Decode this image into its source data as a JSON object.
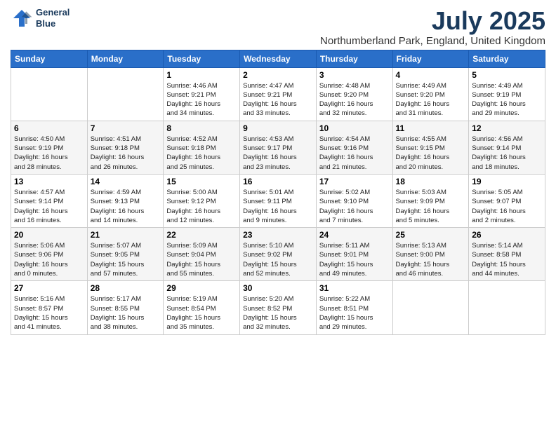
{
  "logo": {
    "line1": "General",
    "line2": "Blue"
  },
  "title": "July 2025",
  "subtitle": "Northumberland Park, England, United Kingdom",
  "dayHeaders": [
    "Sunday",
    "Monday",
    "Tuesday",
    "Wednesday",
    "Thursday",
    "Friday",
    "Saturday"
  ],
  "weeks": [
    [
      {
        "day": "",
        "info": "",
        "empty": true
      },
      {
        "day": "",
        "info": "",
        "empty": true
      },
      {
        "day": "1",
        "info": "Sunrise: 4:46 AM\nSunset: 9:21 PM\nDaylight: 16 hours\nand 34 minutes."
      },
      {
        "day": "2",
        "info": "Sunrise: 4:47 AM\nSunset: 9:21 PM\nDaylight: 16 hours\nand 33 minutes."
      },
      {
        "day": "3",
        "info": "Sunrise: 4:48 AM\nSunset: 9:20 PM\nDaylight: 16 hours\nand 32 minutes."
      },
      {
        "day": "4",
        "info": "Sunrise: 4:49 AM\nSunset: 9:20 PM\nDaylight: 16 hours\nand 31 minutes."
      },
      {
        "day": "5",
        "info": "Sunrise: 4:49 AM\nSunset: 9:19 PM\nDaylight: 16 hours\nand 29 minutes."
      }
    ],
    [
      {
        "day": "6",
        "info": "Sunrise: 4:50 AM\nSunset: 9:19 PM\nDaylight: 16 hours\nand 28 minutes."
      },
      {
        "day": "7",
        "info": "Sunrise: 4:51 AM\nSunset: 9:18 PM\nDaylight: 16 hours\nand 26 minutes."
      },
      {
        "day": "8",
        "info": "Sunrise: 4:52 AM\nSunset: 9:18 PM\nDaylight: 16 hours\nand 25 minutes."
      },
      {
        "day": "9",
        "info": "Sunrise: 4:53 AM\nSunset: 9:17 PM\nDaylight: 16 hours\nand 23 minutes."
      },
      {
        "day": "10",
        "info": "Sunrise: 4:54 AM\nSunset: 9:16 PM\nDaylight: 16 hours\nand 21 minutes."
      },
      {
        "day": "11",
        "info": "Sunrise: 4:55 AM\nSunset: 9:15 PM\nDaylight: 16 hours\nand 20 minutes."
      },
      {
        "day": "12",
        "info": "Sunrise: 4:56 AM\nSunset: 9:14 PM\nDaylight: 16 hours\nand 18 minutes."
      }
    ],
    [
      {
        "day": "13",
        "info": "Sunrise: 4:57 AM\nSunset: 9:14 PM\nDaylight: 16 hours\nand 16 minutes."
      },
      {
        "day": "14",
        "info": "Sunrise: 4:59 AM\nSunset: 9:13 PM\nDaylight: 16 hours\nand 14 minutes."
      },
      {
        "day": "15",
        "info": "Sunrise: 5:00 AM\nSunset: 9:12 PM\nDaylight: 16 hours\nand 12 minutes."
      },
      {
        "day": "16",
        "info": "Sunrise: 5:01 AM\nSunset: 9:11 PM\nDaylight: 16 hours\nand 9 minutes."
      },
      {
        "day": "17",
        "info": "Sunrise: 5:02 AM\nSunset: 9:10 PM\nDaylight: 16 hours\nand 7 minutes."
      },
      {
        "day": "18",
        "info": "Sunrise: 5:03 AM\nSunset: 9:09 PM\nDaylight: 16 hours\nand 5 minutes."
      },
      {
        "day": "19",
        "info": "Sunrise: 5:05 AM\nSunset: 9:07 PM\nDaylight: 16 hours\nand 2 minutes."
      }
    ],
    [
      {
        "day": "20",
        "info": "Sunrise: 5:06 AM\nSunset: 9:06 PM\nDaylight: 16 hours\nand 0 minutes."
      },
      {
        "day": "21",
        "info": "Sunrise: 5:07 AM\nSunset: 9:05 PM\nDaylight: 15 hours\nand 57 minutes."
      },
      {
        "day": "22",
        "info": "Sunrise: 5:09 AM\nSunset: 9:04 PM\nDaylight: 15 hours\nand 55 minutes."
      },
      {
        "day": "23",
        "info": "Sunrise: 5:10 AM\nSunset: 9:02 PM\nDaylight: 15 hours\nand 52 minutes."
      },
      {
        "day": "24",
        "info": "Sunrise: 5:11 AM\nSunset: 9:01 PM\nDaylight: 15 hours\nand 49 minutes."
      },
      {
        "day": "25",
        "info": "Sunrise: 5:13 AM\nSunset: 9:00 PM\nDaylight: 15 hours\nand 46 minutes."
      },
      {
        "day": "26",
        "info": "Sunrise: 5:14 AM\nSunset: 8:58 PM\nDaylight: 15 hours\nand 44 minutes."
      }
    ],
    [
      {
        "day": "27",
        "info": "Sunrise: 5:16 AM\nSunset: 8:57 PM\nDaylight: 15 hours\nand 41 minutes."
      },
      {
        "day": "28",
        "info": "Sunrise: 5:17 AM\nSunset: 8:55 PM\nDaylight: 15 hours\nand 38 minutes."
      },
      {
        "day": "29",
        "info": "Sunrise: 5:19 AM\nSunset: 8:54 PM\nDaylight: 15 hours\nand 35 minutes."
      },
      {
        "day": "30",
        "info": "Sunrise: 5:20 AM\nSunset: 8:52 PM\nDaylight: 15 hours\nand 32 minutes."
      },
      {
        "day": "31",
        "info": "Sunrise: 5:22 AM\nSunset: 8:51 PM\nDaylight: 15 hours\nand 29 minutes."
      },
      {
        "day": "",
        "info": "",
        "empty": true
      },
      {
        "day": "",
        "info": "",
        "empty": true
      }
    ]
  ]
}
